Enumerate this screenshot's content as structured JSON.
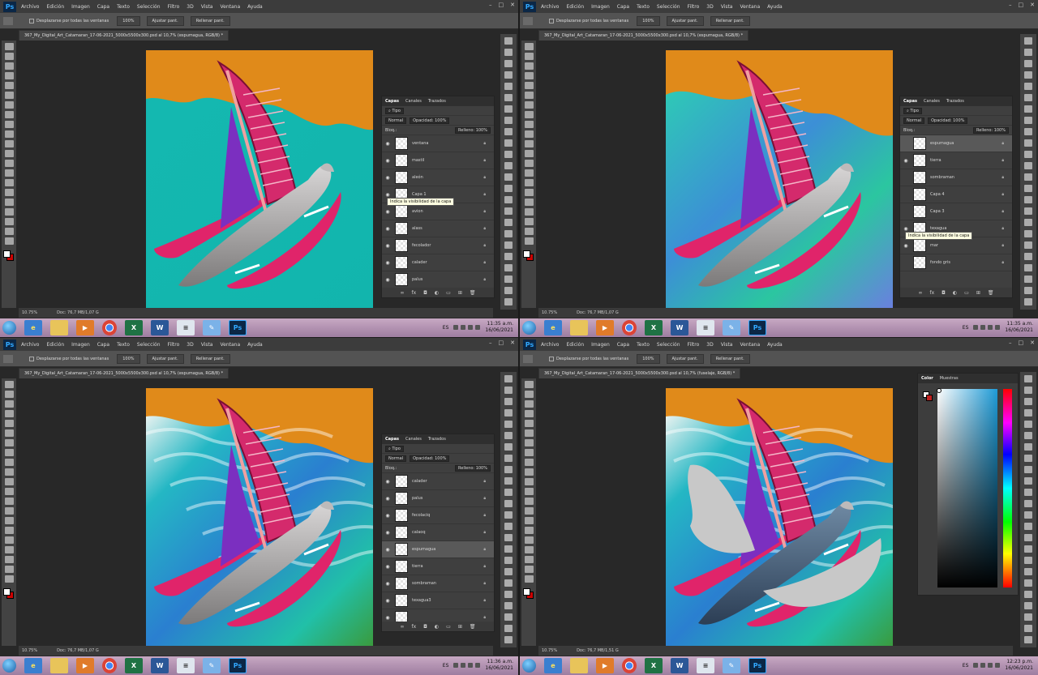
{
  "menu": {
    "logo": "Ps",
    "items": [
      "Archivo",
      "Edición",
      "Imagen",
      "Capa",
      "Texto",
      "Selección",
      "Filtro",
      "3D",
      "Vista",
      "Ventana",
      "Ayuda"
    ]
  },
  "options": {
    "scroll_all": "Desplazarse por todas las ventanas",
    "zoom": "100%",
    "fit_screen": "Ajustar pant.",
    "fill_screen": "Rellenar pant."
  },
  "status": {
    "zoom": "10.75%"
  },
  "taskbar": {
    "lang": "ES"
  },
  "quadrants": [
    {
      "doc_tab": "367_My_Digital_Art_Catamaran_17-06-2021_5000x5500x300.psd al 10,7% (espumagua, RGB/8) *",
      "doc_info": "Doc: 76,7 MB/1,07 G",
      "clock_time": "11:35 a.m.",
      "clock_date": "16/06/2021",
      "layers_panel": {
        "tabs": [
          "Capas",
          "Canales",
          "Trazados"
        ],
        "filter": "Tipo",
        "blend": "Normal",
        "opacity": "Opacidad: 100%",
        "fill": "Relleno: 100%",
        "lock": "Bloq.:",
        "tooltip": "Indica la visibilidad de la capa",
        "layers": [
          {
            "name": "ventana",
            "eye": true,
            "sel": false
          },
          {
            "name": "mastil",
            "eye": true,
            "sel": false
          },
          {
            "name": "aleón",
            "eye": true,
            "sel": false
          },
          {
            "name": "Capa 1",
            "eye": true,
            "sel": false
          },
          {
            "name": "avion",
            "eye": true,
            "sel": false
          },
          {
            "name": "alass",
            "eye": true,
            "sel": false
          },
          {
            "name": "fecolador",
            "eye": true,
            "sel": false
          },
          {
            "name": "calader",
            "eye": true,
            "sel": false
          },
          {
            "name": "palus",
            "eye": true,
            "sel": false
          }
        ]
      }
    },
    {
      "doc_tab": "367_My_Digital_Art_Catamaran_17-06-2021_5000x5500x300.psd al 10,7% (espumagua, RGB/8) *",
      "doc_info": "Doc: 76,7 MB/1,07 G",
      "clock_time": "11:35 a.m.",
      "clock_date": "16/06/2021",
      "layers_panel": {
        "tabs": [
          "Capas",
          "Canales",
          "Trazados"
        ],
        "filter": "Tipo",
        "blend": "Normal",
        "opacity": "Opacidad: 100%",
        "fill": "Relleno: 100%",
        "lock": "Bloq.:",
        "tooltip": "Indica la visibilidad de la capa",
        "layers": [
          {
            "name": "espumagua",
            "eye": false,
            "sel": true
          },
          {
            "name": "tierra",
            "eye": true,
            "sel": false
          },
          {
            "name": "sombraman",
            "eye": false,
            "sel": false
          },
          {
            "name": "Capa 4",
            "eye": false,
            "sel": false
          },
          {
            "name": "Capa 3",
            "eye": false,
            "sel": false
          },
          {
            "name": "texagua",
            "eye": true,
            "sel": false
          },
          {
            "name": "mar",
            "eye": true,
            "sel": false
          },
          {
            "name": "fondo gris",
            "eye": false,
            "sel": false
          }
        ]
      }
    },
    {
      "doc_tab": "367_My_Digital_Art_Catamaran_17-06-2021_5000x5500x300.psd al 10,7% (espumagua, RGB/8) *",
      "doc_info": "Doc: 76,7 MB/1,07 G",
      "clock_time": "11:36 a.m.",
      "clock_date": "16/06/2021",
      "layers_panel": {
        "tabs": [
          "Capas",
          "Canales",
          "Trazados"
        ],
        "filter": "Tipo",
        "blend": "Normal",
        "opacity": "Opacidad: 100%",
        "fill": "Relleno: 100%",
        "lock": "Bloq.:",
        "tooltip": "",
        "layers": [
          {
            "name": "calader",
            "eye": true,
            "sel": false
          },
          {
            "name": "palus",
            "eye": true,
            "sel": false
          },
          {
            "name": "fecolaciq",
            "eye": true,
            "sel": false
          },
          {
            "name": "calaoq",
            "eye": true,
            "sel": false
          },
          {
            "name": "espumagua",
            "eye": true,
            "sel": true
          },
          {
            "name": "tierra",
            "eye": true,
            "sel": false
          },
          {
            "name": "sombraman",
            "eye": true,
            "sel": false
          },
          {
            "name": "texagua3",
            "eye": true,
            "sel": false
          },
          {
            "name": "",
            "eye": true,
            "sel": false
          }
        ]
      }
    },
    {
      "doc_tab": "367_My_Digital_Art_Catamaran_17-06-2021_5000x5500x300.psd al 10,7% (fuselaje, RGB/8) *",
      "doc_info": "Doc: 76,7 MB/1,51 G",
      "clock_time": "12:23 p.m.",
      "clock_date": "16/06/2021",
      "color_panel": {
        "tabs": [
          "Color",
          "Muestras"
        ]
      }
    }
  ]
}
